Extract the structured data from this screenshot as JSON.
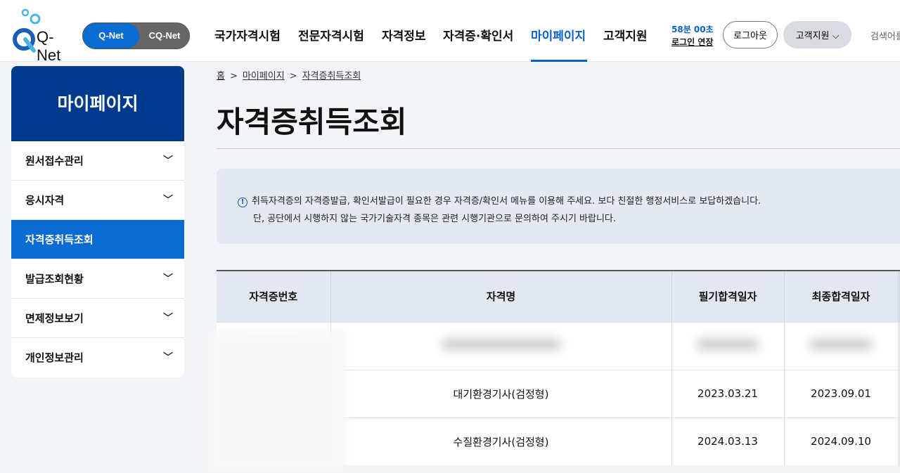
{
  "header": {
    "logo": "Q-Net",
    "toggle": [
      "Q-Net",
      "CQ-Net"
    ],
    "nav": [
      "국가자격시험",
      "전문자격시험",
      "자격정보",
      "자격증·확인서",
      "마이페이지",
      "고객지원"
    ],
    "timer": "58분 00초",
    "extend": "로그인 연장",
    "logout": "로그아웃",
    "support": "고객지원",
    "search_hint": "검색어를"
  },
  "sidebar": {
    "title": "마이페이지",
    "items": [
      "원서접수관리",
      "응시자격",
      "자격증취득조회",
      "발급조회현황",
      "면제정보보기",
      "개인정보관리"
    ]
  },
  "breadcrumb": [
    "홈",
    "마이페이지",
    "자격증취득조회"
  ],
  "page_title": "자격증취득조회",
  "notice": [
    "취득자격증의 자격증발급, 확인서발급이 필요한 경우 자격증/확인서 메뉴를 이용해 주세요. 보다 친절한 행정서비스로 보답하겠습니다.",
    "단, 공단에서 시행하지 않는 국가기술자격 종목은 관련 시행기관으로 문의하여 주시기 바랍니다."
  ],
  "table": {
    "headers": [
      "자격증번호",
      "자격명",
      "필기합격일자",
      "최종합격일자"
    ],
    "rows": [
      [
        "",
        "",
        "",
        ""
      ],
      [
        "",
        "대기환경기사(검정형)",
        "2023.03.21",
        "2023.09.01"
      ],
      [
        "",
        "수질환경기사(검정형)",
        "2024.03.13",
        "2024.09.10"
      ]
    ]
  }
}
